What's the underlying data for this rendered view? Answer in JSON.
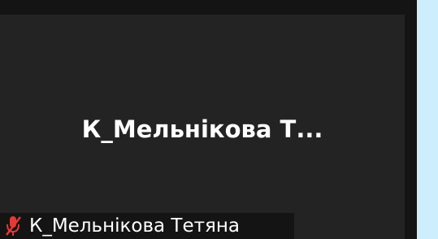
{
  "participant_tile": {
    "center_name": "К_Мельнікова Т...",
    "label_name": "К_Мельнікова Тетяна",
    "mic_state": "muted",
    "mic_icon": "muted-mic-icon",
    "colors": {
      "tile_bg": "#232323",
      "label_bg": "#141414",
      "page_bg": "#cdeefd",
      "mic_red": "#e53935",
      "text": "#ffffff"
    }
  }
}
